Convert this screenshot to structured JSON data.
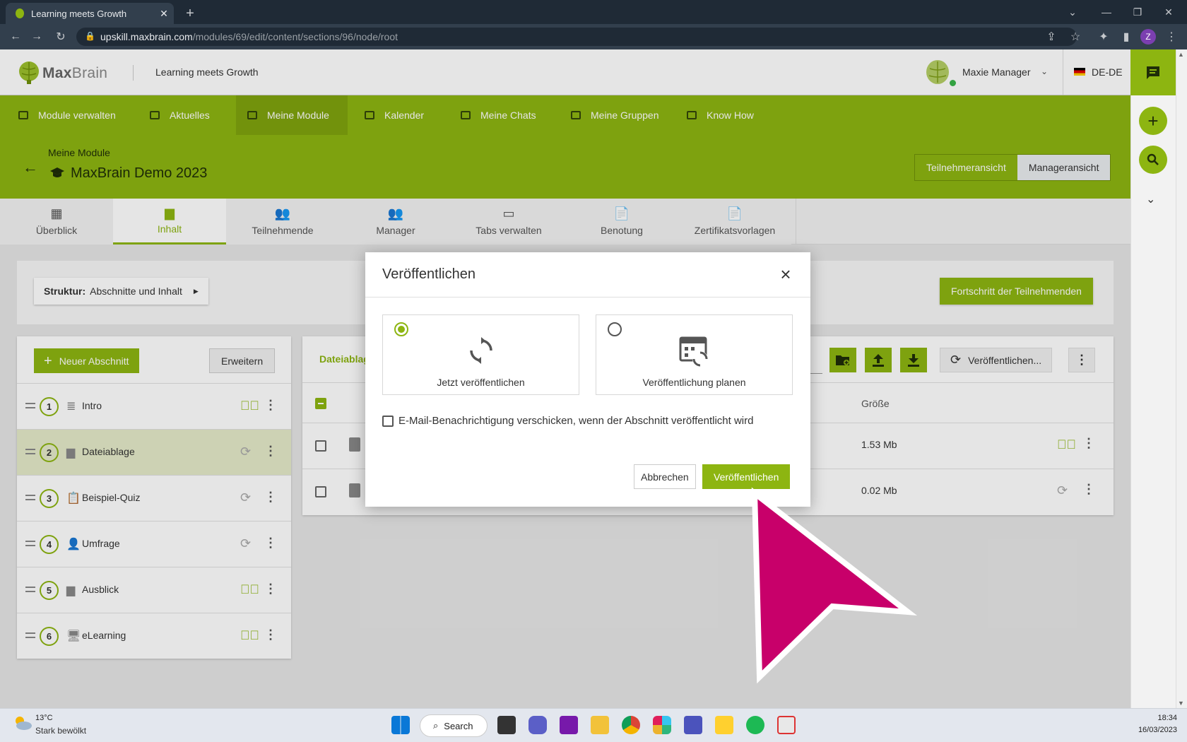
{
  "browser": {
    "tab_title": "Learning meets Growth",
    "url_host": "upskill.maxbrain.com",
    "url_path": "/modules/69/edit/content/sections/96/node/root",
    "profile_initial": "Z"
  },
  "header": {
    "logo_text": "Max",
    "logo_text2": "Brain",
    "tagline": "Learning meets Growth",
    "user_name": "Maxie Manager",
    "language": "DE-DE"
  },
  "nav": {
    "items": [
      {
        "label": "Module verwalten"
      },
      {
        "label": "Aktuelles"
      },
      {
        "label": "Meine Module"
      },
      {
        "label": "Kalender"
      },
      {
        "label": "Meine Chats"
      },
      {
        "label": "Meine Gruppen"
      },
      {
        "label": "Know How"
      }
    ]
  },
  "module": {
    "breadcrumb": "Meine Module",
    "title": "MaxBrain Demo 2023",
    "view_participant": "Teilnehmeransicht",
    "view_manager": "Manageransicht"
  },
  "tabs": [
    {
      "label": "Überblick",
      "icon": "▦"
    },
    {
      "label": "Inhalt",
      "icon": "▆"
    },
    {
      "label": "Teilnehmende",
      "icon": "👥"
    },
    {
      "label": "Manager",
      "icon": "👥"
    },
    {
      "label": "Tabs verwalten",
      "icon": "▭"
    },
    {
      "label": "Benotung",
      "icon": "📄"
    },
    {
      "label": "Zertifikatsvorlagen",
      "icon": "📄"
    }
  ],
  "structure": {
    "label_bold": "Struktur:",
    "label_rest": "Abschnitte und Inhalt"
  },
  "progress_button": "Fortschritt der Teilnehmenden",
  "left_panel": {
    "new_section": "Neuer Abschnitt",
    "expand": "Erweitern",
    "sections": [
      {
        "num": "1",
        "name": "Intro",
        "icon": "≣",
        "status": "published"
      },
      {
        "num": "2",
        "name": "Dateiablage",
        "icon": "▆",
        "status": "sync"
      },
      {
        "num": "3",
        "name": "Beispiel-Quiz",
        "icon": "📋",
        "status": "sync"
      },
      {
        "num": "4",
        "name": "Umfrage",
        "icon": "👤",
        "status": "sync"
      },
      {
        "num": "5",
        "name": "Ausblick",
        "icon": "▆",
        "status": "published"
      },
      {
        "num": "6",
        "name": "eLearning",
        "icon": "🖥",
        "status": "published"
      }
    ]
  },
  "right_panel": {
    "tab_label": "Dateiablag",
    "publish_button": "Veröffentlichen...",
    "col_size": "Größe",
    "files": [
      {
        "size": "1.53 Mb",
        "status": "published"
      },
      {
        "size": "0.02 Mb",
        "status": "sync"
      }
    ]
  },
  "dialog": {
    "title": "Veröffentlichen",
    "option_now": "Jetzt veröffentlichen",
    "option_plan": "Veröffentlichung planen",
    "email_label": "E-Mail-Benachrichtigung verschicken, wenn der Abschnitt veröffentlicht wird",
    "cancel": "Abbrechen",
    "publish": "Veröffentlichen",
    "selected_option": "now",
    "email_checked": false
  },
  "taskbar": {
    "temperature": "13°C",
    "weather": "Stark bewölkt",
    "search": "Search",
    "time": "18:34",
    "date": "16/03/2023"
  },
  "colors": {
    "brand_green": "#8db511",
    "cursor_magenta": "#c8006a"
  }
}
